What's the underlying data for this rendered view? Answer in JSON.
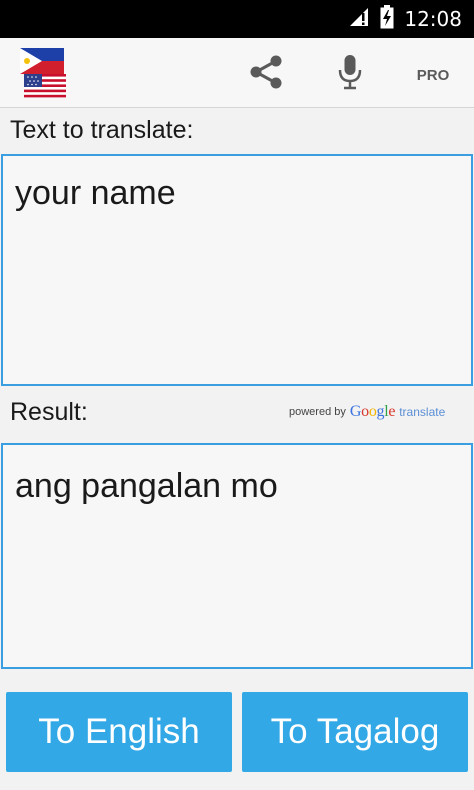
{
  "status_bar": {
    "time": "12:08"
  },
  "action_bar": {
    "app_icon": "philippines-us-flag-icon",
    "share_icon": "share-icon",
    "mic_icon": "microphone-icon",
    "pro_label": "PRO"
  },
  "source": {
    "label": "Text to translate:",
    "value": "your name"
  },
  "result": {
    "label": "Result:",
    "value": "ang pangalan mo"
  },
  "powered_by": {
    "prefix": "powered by",
    "brand": "Google",
    "suffix": "translate"
  },
  "buttons": {
    "to_english": "To English",
    "to_tagalog": "To Tagalog"
  },
  "colors": {
    "accent": "#33a8e6",
    "border": "#3a9ee0"
  }
}
